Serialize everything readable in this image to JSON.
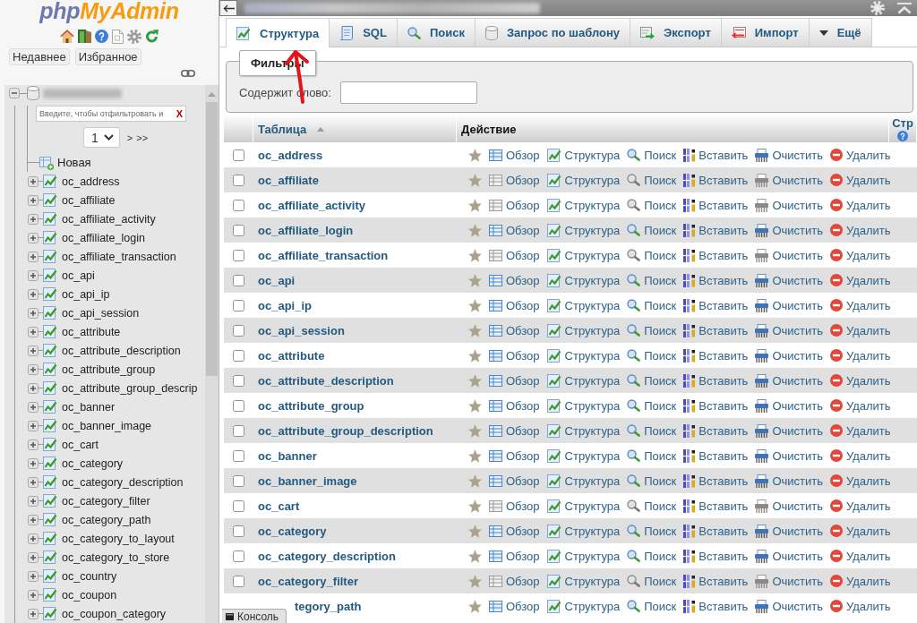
{
  "sidebar": {
    "logo": [
      "php",
      "MyAdmin"
    ],
    "buttons": [
      "Недавнее",
      "Избранное"
    ],
    "tree": [
      {
        "expanded": true,
        "filter": {
          "placeholder": "Введите, чтобы отфильтровать и",
          "clear": "X"
        },
        "pager": {
          "page": "1",
          "links": [
            ">",
            ">>"
          ]
        },
        "children": [
          {
            "kind": "new",
            "label": "Новая"
          },
          {
            "kind": "table",
            "label": "oc_address",
            "expanded": false
          },
          {
            "kind": "table",
            "label": "oc_affiliate",
            "expanded": false
          },
          {
            "kind": "table",
            "label": "oc_affiliate_activity",
            "expanded": false
          },
          {
            "kind": "table",
            "label": "oc_affiliate_login",
            "expanded": false
          },
          {
            "kind": "table",
            "label": "oc_affiliate_transaction",
            "expanded": false
          },
          {
            "kind": "table",
            "label": "oc_api",
            "expanded": false
          },
          {
            "kind": "table",
            "label": "oc_api_ip",
            "expanded": false
          },
          {
            "kind": "table",
            "label": "oc_api_session",
            "expanded": false
          },
          {
            "kind": "table",
            "label": "oc_attribute",
            "expanded": false
          },
          {
            "kind": "table",
            "label": "oc_attribute_description",
            "expanded": false
          },
          {
            "kind": "table",
            "label": "oc_attribute_group",
            "expanded": false
          },
          {
            "kind": "table",
            "label": "oc_attribute_group_descrip",
            "expanded": false
          },
          {
            "kind": "table",
            "label": "oc_banner",
            "expanded": false
          },
          {
            "kind": "table",
            "label": "oc_banner_image",
            "expanded": false
          },
          {
            "kind": "table",
            "label": "oc_cart",
            "expanded": false
          },
          {
            "kind": "table",
            "label": "oc_category",
            "expanded": false
          },
          {
            "kind": "table",
            "label": "oc_category_description",
            "expanded": false
          },
          {
            "kind": "table",
            "label": "oc_category_filter",
            "expanded": false
          },
          {
            "kind": "table",
            "label": "oc_category_path",
            "expanded": false
          },
          {
            "kind": "table",
            "label": "oc_category_to_layout",
            "expanded": false
          },
          {
            "kind": "table",
            "label": "oc_category_to_store",
            "expanded": false
          },
          {
            "kind": "table",
            "label": "oc_country",
            "expanded": false
          },
          {
            "kind": "table",
            "label": "oc_coupon",
            "expanded": false
          },
          {
            "kind": "table",
            "label": "oc_coupon_category",
            "expanded": false
          }
        ]
      }
    ]
  },
  "tabs": [
    {
      "label": "Структура",
      "selected": true
    },
    {
      "label": "SQL",
      "selected": false
    },
    {
      "label": "Поиск",
      "selected": false
    },
    {
      "label": "Запрос по шаблону",
      "selected": false
    },
    {
      "label": "Экспорт",
      "selected": false
    },
    {
      "label": "Импорт",
      "selected": false
    },
    {
      "label": "Ещё",
      "selected": false
    }
  ],
  "filter": {
    "legend": "Фильтры",
    "label": "Содержит слово:"
  },
  "table": {
    "columns": [
      {
        "label": "Таблица",
        "sorted": true
      },
      {
        "label": "Действие",
        "sorted": false
      },
      {
        "label": "Стр",
        "sorted": false
      }
    ],
    "rows": [
      {
        "name": "oc_address",
        "checked": false,
        "favorite": false,
        "empty": false,
        "actions": [
          "Обзор",
          "Структура",
          "Поиск",
          "Вставить",
          "Очистить",
          "Удалить"
        ]
      },
      {
        "name": "oc_affiliate",
        "checked": false,
        "favorite": false,
        "empty": true,
        "actions": [
          "Обзор",
          "Структура",
          "Поиск",
          "Вставить",
          "Очистить",
          "Удалить"
        ]
      },
      {
        "name": "oc_affiliate_activity",
        "checked": false,
        "favorite": false,
        "empty": true,
        "actions": [
          "Обзор",
          "Структура",
          "Поиск",
          "Вставить",
          "Очистить",
          "Удалить"
        ]
      },
      {
        "name": "oc_affiliate_login",
        "checked": false,
        "favorite": false,
        "empty": false,
        "actions": [
          "Обзор",
          "Структура",
          "Поиск",
          "Вставить",
          "Очистить",
          "Удалить"
        ]
      },
      {
        "name": "oc_affiliate_transaction",
        "checked": false,
        "favorite": false,
        "empty": true,
        "actions": [
          "Обзор",
          "Структура",
          "Поиск",
          "Вставить",
          "Очистить",
          "Удалить"
        ]
      },
      {
        "name": "oc_api",
        "checked": false,
        "favorite": false,
        "empty": false,
        "actions": [
          "Обзор",
          "Структура",
          "Поиск",
          "Вставить",
          "Очистить",
          "Удалить"
        ]
      },
      {
        "name": "oc_api_ip",
        "checked": false,
        "favorite": false,
        "empty": false,
        "actions": [
          "Обзор",
          "Структура",
          "Поиск",
          "Вставить",
          "Очистить",
          "Удалить"
        ]
      },
      {
        "name": "oc_api_session",
        "checked": false,
        "favorite": false,
        "empty": false,
        "actions": [
          "Обзор",
          "Структура",
          "Поиск",
          "Вставить",
          "Очистить",
          "Удалить"
        ]
      },
      {
        "name": "oc_attribute",
        "checked": false,
        "favorite": false,
        "empty": false,
        "actions": [
          "Обзор",
          "Структура",
          "Поиск",
          "Вставить",
          "Очистить",
          "Удалить"
        ]
      },
      {
        "name": "oc_attribute_description",
        "checked": false,
        "favorite": false,
        "empty": false,
        "actions": [
          "Обзор",
          "Структура",
          "Поиск",
          "Вставить",
          "Очистить",
          "Удалить"
        ]
      },
      {
        "name": "oc_attribute_group",
        "checked": false,
        "favorite": false,
        "empty": false,
        "actions": [
          "Обзор",
          "Структура",
          "Поиск",
          "Вставить",
          "Очистить",
          "Удалить"
        ]
      },
      {
        "name": "oc_attribute_group_description",
        "checked": false,
        "favorite": false,
        "empty": false,
        "actions": [
          "Обзор",
          "Структура",
          "Поиск",
          "Вставить",
          "Очистить",
          "Удалить"
        ]
      },
      {
        "name": "oc_banner",
        "checked": false,
        "favorite": false,
        "empty": false,
        "actions": [
          "Обзор",
          "Структура",
          "Поиск",
          "Вставить",
          "Очистить",
          "Удалить"
        ]
      },
      {
        "name": "oc_banner_image",
        "checked": false,
        "favorite": false,
        "empty": false,
        "actions": [
          "Обзор",
          "Структура",
          "Поиск",
          "Вставить",
          "Очистить",
          "Удалить"
        ]
      },
      {
        "name": "oc_cart",
        "checked": false,
        "favorite": false,
        "empty": true,
        "actions": [
          "Обзор",
          "Структура",
          "Поиск",
          "Вставить",
          "Очистить",
          "Удалить"
        ]
      },
      {
        "name": "oc_category",
        "checked": false,
        "favorite": false,
        "empty": false,
        "actions": [
          "Обзор",
          "Структура",
          "Поиск",
          "Вставить",
          "Очистить",
          "Удалить"
        ]
      },
      {
        "name": "oc_category_description",
        "checked": false,
        "favorite": false,
        "empty": false,
        "actions": [
          "Обзор",
          "Структура",
          "Поиск",
          "Вставить",
          "Очистить",
          "Удалить"
        ]
      },
      {
        "name": "oc_category_filter",
        "checked": false,
        "favorite": false,
        "empty": true,
        "actions": [
          "Обзор",
          "Структура",
          "Поиск",
          "Вставить",
          "Очистить",
          "Удалить"
        ]
      },
      {
        "name": "tegory_path",
        "favorite": false,
        "empty": false,
        "actions": [
          "Обзор",
          "Структура",
          "Поиск",
          "Вставить",
          "Очистить",
          "Удалить"
        ]
      }
    ]
  },
  "console": {
    "label": "Консоль"
  }
}
